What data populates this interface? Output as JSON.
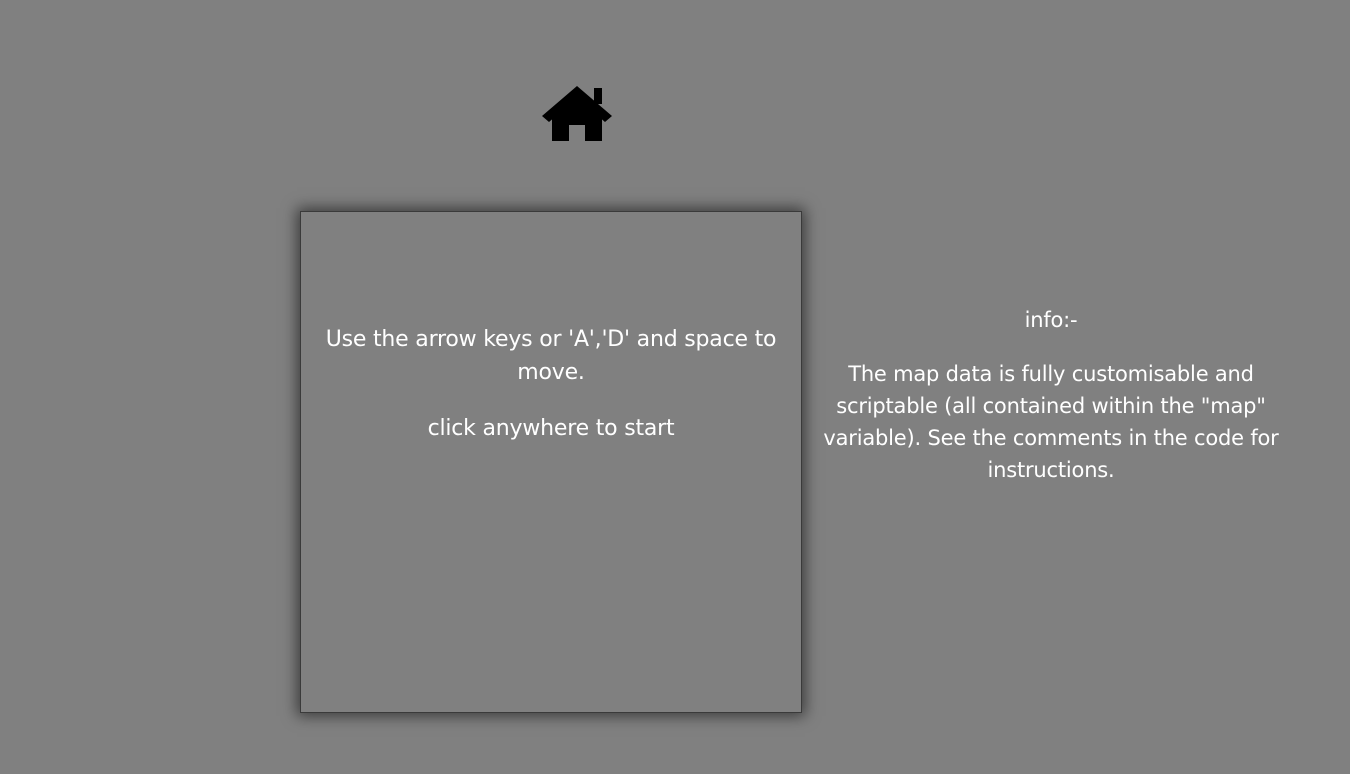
{
  "home": {
    "icon": "home-icon",
    "color": "#000000"
  },
  "game": {
    "instructions": "Use the arrow keys or 'A','D' and space to move.",
    "start_prompt": "click anywhere to start",
    "background": "#808080"
  },
  "info": {
    "heading": "info:-",
    "body": "The map data is fully customisable and scriptable (all contained within the \"map\" variable). See the comments in the code for instructions."
  }
}
